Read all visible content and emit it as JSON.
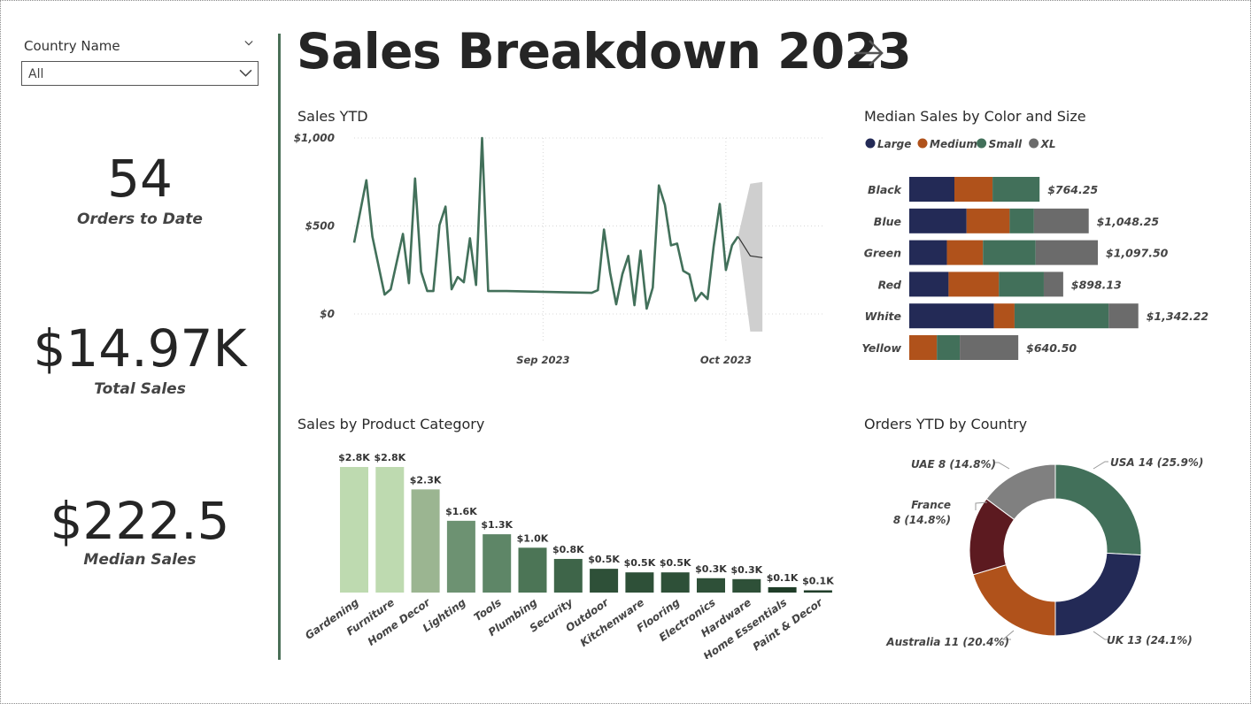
{
  "filter": {
    "label": "Country Name",
    "value": "All"
  },
  "kpis": {
    "orders": {
      "value": "54",
      "label": "Orders to Date"
    },
    "total_sales": {
      "value": "$14.97K",
      "label": "Total Sales"
    },
    "median_sales": {
      "value": "$222.5",
      "label": "Median Sales"
    }
  },
  "page": {
    "title": "Sales Breakdown 2023"
  },
  "chart_data": [
    {
      "id": "sales_ytd",
      "type": "line",
      "title": "Sales YTD",
      "ylim": [
        0,
        1000
      ],
      "y_ticks": [
        "$0",
        "$500",
        "$1,000"
      ],
      "x_ticks": [
        {
          "label": "Sep 2023",
          "x": 31
        },
        {
          "label": "Oct 2023",
          "x": 61
        }
      ],
      "xlim": [
        0,
        77
      ],
      "x": [
        0,
        2,
        3,
        5,
        6,
        8,
        9,
        10,
        11,
        12,
        13,
        14,
        15,
        16,
        17,
        18,
        19,
        20,
        21,
        22,
        24,
        25,
        39,
        40,
        41,
        42,
        43,
        44,
        45,
        46,
        47,
        48,
        49,
        50,
        51,
        52,
        53,
        54,
        55,
        56,
        57,
        58,
        59,
        60,
        61,
        62,
        63
      ],
      "y": [
        405,
        760,
        440,
        110,
        140,
        455,
        175,
        770,
        240,
        130,
        130,
        505,
        610,
        140,
        210,
        180,
        430,
        165,
        1000,
        130,
        130,
        130,
        120,
        135,
        480,
        235,
        55,
        225,
        330,
        50,
        360,
        30,
        150,
        730,
        620,
        390,
        400,
        245,
        225,
        75,
        120,
        85,
        385,
        625,
        250,
        390,
        440
      ],
      "forecast": {
        "x": [
          63,
          65,
          67
        ],
        "y": [
          440,
          330,
          320
        ],
        "band_low": [
          440,
          -100,
          -100
        ],
        "band_high": [
          440,
          740,
          750
        ]
      },
      "grid": true
    },
    {
      "id": "median_color_size",
      "type": "bar",
      "orientation": "horizontal",
      "stacked": true,
      "title": "Median Sales by Color and Size",
      "categories": [
        "Black",
        "Blue",
        "Green",
        "Red",
        "White",
        "Yellow"
      ],
      "series": [
        {
          "name": "Large",
          "color": "#232a56",
          "values": [
            193,
            245,
            161,
            168,
            362,
            0
          ]
        },
        {
          "name": "Medium",
          "color": "#b0521b",
          "values": [
            163,
            184,
            154,
            215,
            88,
            118
          ]
        },
        {
          "name": "Small",
          "color": "#42705a",
          "values": [
            201,
            104,
            225,
            192,
            402,
            98
          ]
        },
        {
          "name": "XL",
          "color": "#6b6b6b",
          "values": [
            0,
            234,
            266,
            83,
            127,
            250
          ]
        }
      ],
      "totals": [
        "$764.25",
        "$1,048.25",
        "$1,097.50",
        "$898.13",
        "$1,342.22",
        "$640.50"
      ],
      "xlim": [
        0,
        1400
      ],
      "legend": "top-left"
    },
    {
      "id": "sales_by_category",
      "type": "bar",
      "title": "Sales by Product Category",
      "categories": [
        "Gardening",
        "Furniture",
        "Home Decor",
        "Lighting",
        "Tools",
        "Plumbing",
        "Security",
        "Outdoor",
        "Kitchenware",
        "Flooring",
        "Electronics",
        "Hardware",
        "Home Essentials",
        "Paint & Decor"
      ],
      "values": [
        2.8,
        2.8,
        2.3,
        1.6,
        1.3,
        1.0,
        0.75,
        0.53,
        0.45,
        0.45,
        0.32,
        0.3,
        0.12,
        0.05
      ],
      "data_labels": [
        "$2.8K",
        "$2.8K",
        "$2.3K",
        "$1.6K",
        "$1.3K",
        "$1.0K",
        "$0.8K",
        "$0.5K",
        "$0.5K",
        "$0.5K",
        "$0.3K",
        "$0.3K",
        "$0.1K",
        "$0.1K"
      ],
      "colors": [
        "#bedab0",
        "#bedab0",
        "#9bb591",
        "#6d9272",
        "#5e8667",
        "#4c7556",
        "#3e6549",
        "#2e5038",
        "#2e5038",
        "#2e5038",
        "#2e5038",
        "#2e5038",
        "#1f3d28",
        "#1f3d28"
      ],
      "ylim": [
        0,
        2.8
      ]
    },
    {
      "id": "orders_by_country",
      "type": "pie",
      "donut": true,
      "title": "Orders YTD by Country",
      "slices": [
        {
          "name": "USA",
          "value": 14,
          "label": "USA 14 (25.9%)",
          "color": "#42705a"
        },
        {
          "name": "UK",
          "value": 13,
          "label": "UK 13 (24.1%)",
          "color": "#232a56"
        },
        {
          "name": "Australia",
          "value": 11,
          "label": "Australia 11 (20.4%)",
          "color": "#b0521b"
        },
        {
          "name": "France",
          "value": 8,
          "label_lines": [
            "France",
            "8 (14.8%)"
          ],
          "color": "#5c1a20"
        },
        {
          "name": "UAE",
          "value": 8,
          "label": "UAE 8 (14.8%)",
          "color": "#808080"
        }
      ]
    }
  ]
}
